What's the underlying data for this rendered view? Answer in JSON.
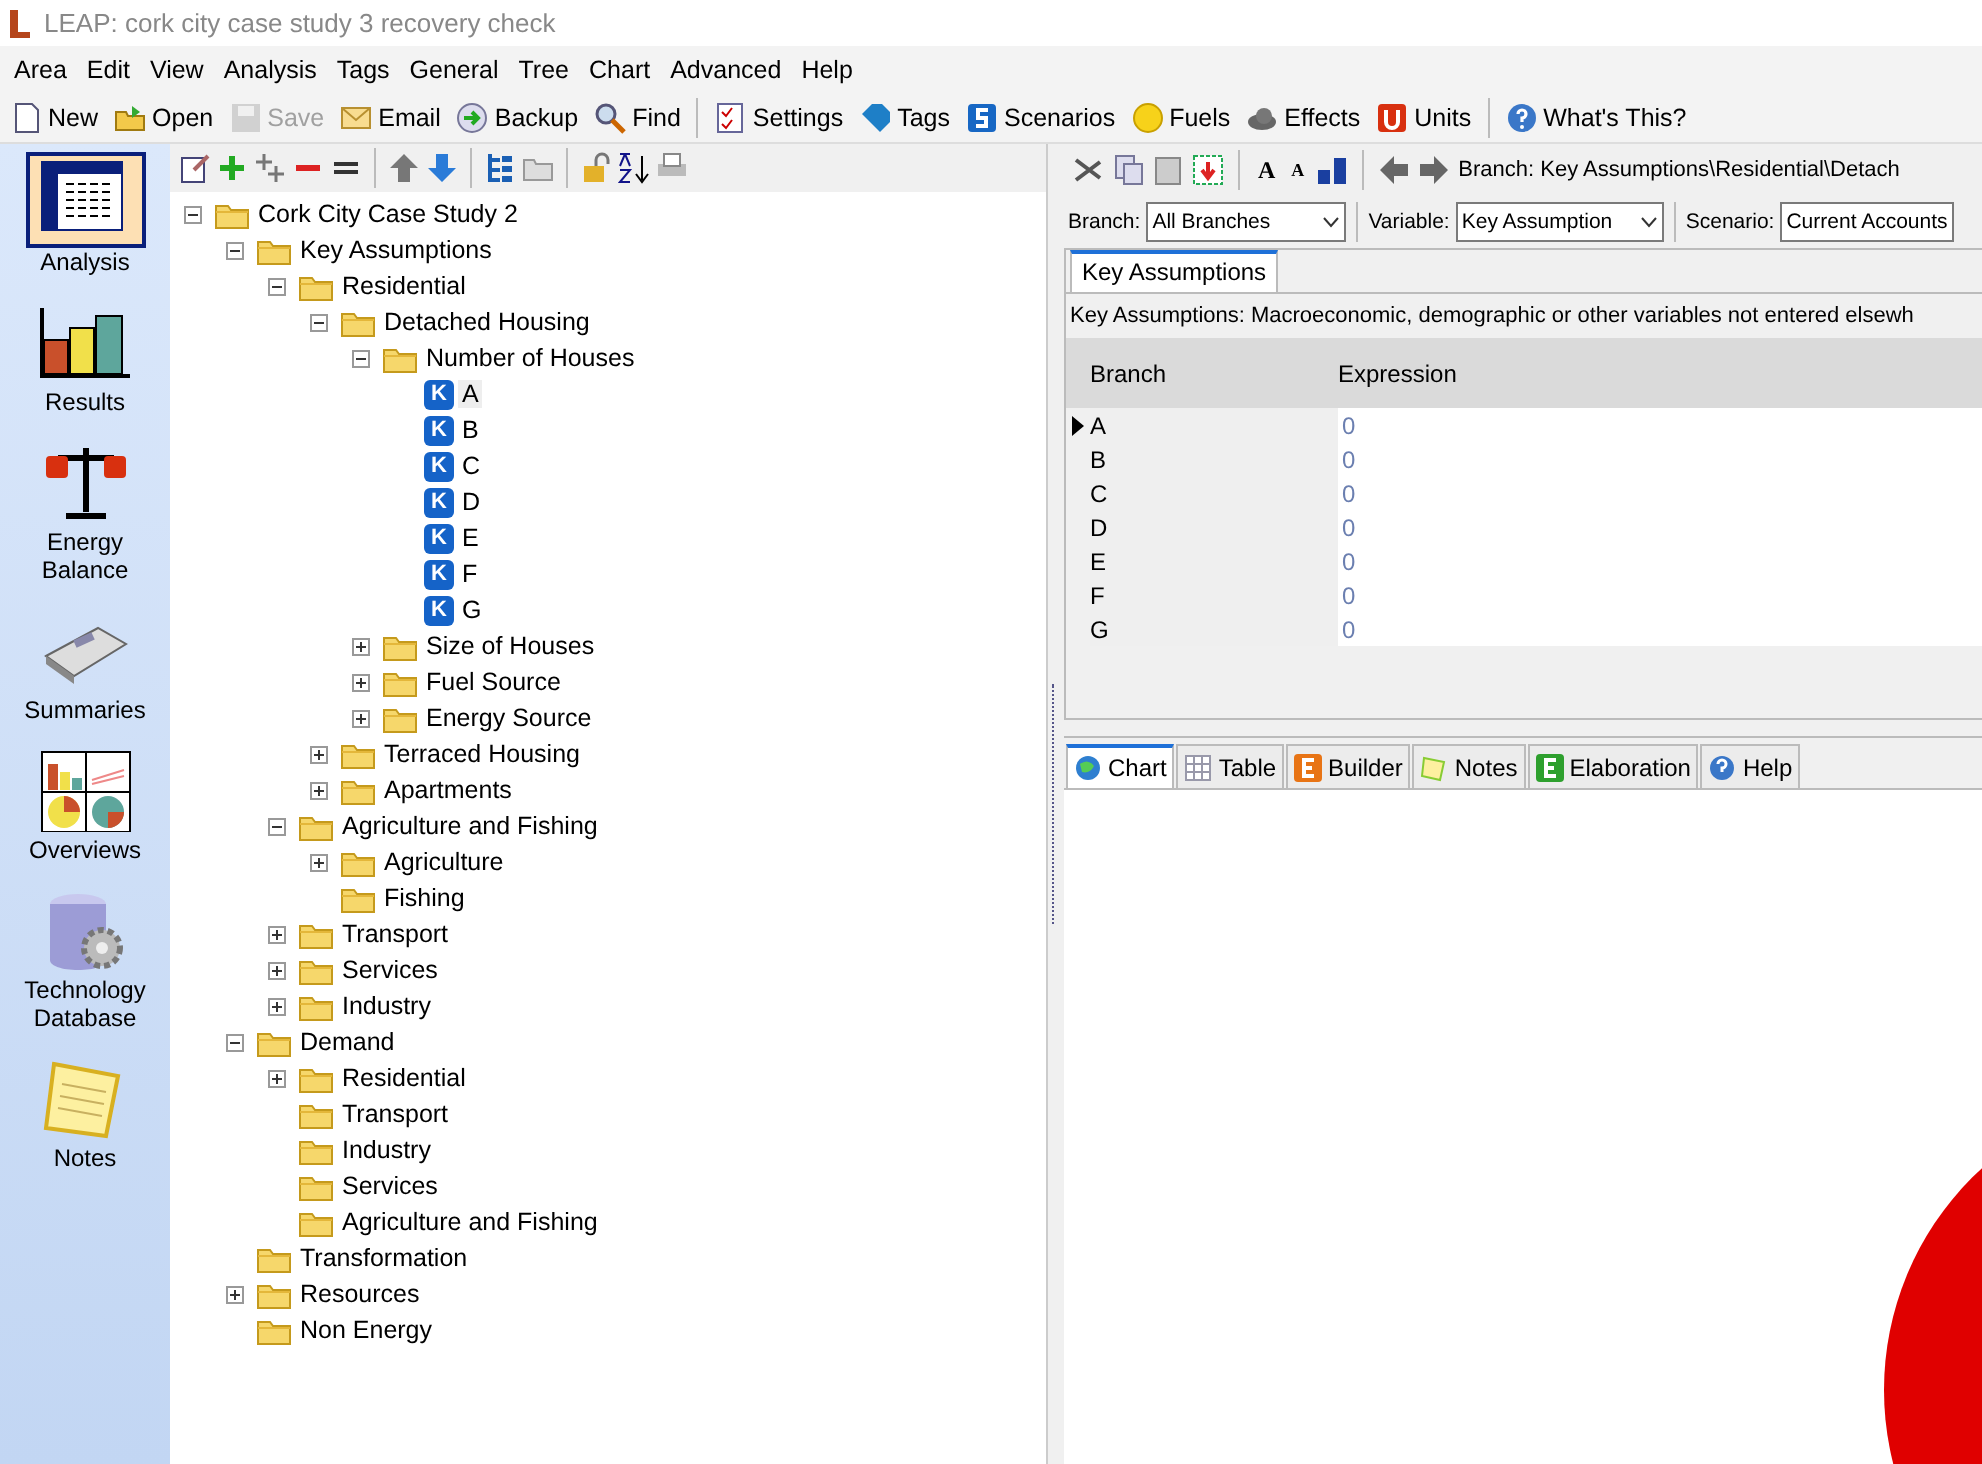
{
  "window": {
    "title": "LEAP: cork city case study 3 recovery check"
  },
  "menu": [
    "Area",
    "Edit",
    "View",
    "Analysis",
    "Tags",
    "General",
    "Tree",
    "Chart",
    "Advanced",
    "Help"
  ],
  "toolbar": [
    {
      "label": "New",
      "disabled": false
    },
    {
      "label": "Open",
      "disabled": false
    },
    {
      "label": "Save",
      "disabled": true
    },
    {
      "label": "Email",
      "disabled": false
    },
    {
      "label": "Backup",
      "disabled": false
    },
    {
      "label": "Find",
      "disabled": false
    },
    {
      "label": "Settings",
      "disabled": false
    },
    {
      "label": "Tags",
      "disabled": false
    },
    {
      "label": "Scenarios",
      "disabled": false
    },
    {
      "label": "Fuels",
      "disabled": false
    },
    {
      "label": "Effects",
      "disabled": false
    },
    {
      "label": "Units",
      "disabled": false
    },
    {
      "label": "What's This?",
      "disabled": false
    }
  ],
  "sidebar": {
    "items": [
      {
        "label": "Analysis",
        "selected": true
      },
      {
        "label": "Results",
        "selected": false
      },
      {
        "label": "Energy Balance",
        "selected": false
      },
      {
        "label": "Summaries",
        "selected": false
      },
      {
        "label": "Overviews",
        "selected": false
      },
      {
        "label": "Technology Database",
        "selected": false
      },
      {
        "label": "Notes",
        "selected": false
      }
    ]
  },
  "tree": {
    "root": {
      "label": "Cork City Case Study 2",
      "kind": "folder",
      "expanded": true,
      "selected": false,
      "children": [
        {
          "label": "Key Assumptions",
          "kind": "folder",
          "expanded": true,
          "selected": false,
          "children": [
            {
              "label": "Residential",
              "kind": "folder",
              "expanded": true,
              "selected": false,
              "children": [
                {
                  "label": "Detached Housing",
                  "kind": "folder",
                  "expanded": true,
                  "selected": false,
                  "children": [
                    {
                      "label": "Number of Houses",
                      "kind": "folder",
                      "expanded": true,
                      "selected": false,
                      "children": [
                        {
                          "label": "A",
                          "kind": "key",
                          "badge": "K",
                          "selected": true
                        },
                        {
                          "label": "B",
                          "kind": "key",
                          "badge": "K",
                          "selected": false
                        },
                        {
                          "label": "C",
                          "kind": "key",
                          "badge": "K",
                          "selected": false
                        },
                        {
                          "label": "D",
                          "kind": "key",
                          "badge": "K",
                          "selected": false
                        },
                        {
                          "label": "E",
                          "kind": "key",
                          "badge": "K",
                          "selected": false
                        },
                        {
                          "label": "F",
                          "kind": "key",
                          "badge": "K",
                          "selected": false
                        },
                        {
                          "label": "G",
                          "kind": "key",
                          "badge": "K",
                          "selected": false
                        }
                      ]
                    },
                    {
                      "label": "Size of Houses",
                      "kind": "folder",
                      "expanded": false,
                      "selected": false
                    },
                    {
                      "label": "Fuel Source",
                      "kind": "folder",
                      "expanded": false,
                      "selected": false
                    },
                    {
                      "label": "Energy Source",
                      "kind": "folder",
                      "expanded": false,
                      "selected": false
                    }
                  ]
                },
                {
                  "label": "Terraced Housing",
                  "kind": "folder",
                  "expanded": false,
                  "selected": false
                },
                {
                  "label": "Apartments",
                  "kind": "folder",
                  "expanded": false,
                  "selected": false
                }
              ]
            },
            {
              "label": "Agriculture and Fishing",
              "kind": "folder",
              "expanded": true,
              "selected": false,
              "children": [
                {
                  "label": "Agriculture",
                  "kind": "folder",
                  "expanded": false,
                  "selected": false
                },
                {
                  "label": "Fishing",
                  "kind": "folder",
                  "selected": false
                }
              ]
            },
            {
              "label": "Transport",
              "kind": "folder",
              "expanded": false,
              "selected": false
            },
            {
              "label": "Services",
              "kind": "folder",
              "expanded": false,
              "selected": false
            },
            {
              "label": "Industry",
              "kind": "folder",
              "expanded": false,
              "selected": false
            }
          ]
        },
        {
          "label": "Demand",
          "kind": "folder",
          "expanded": true,
          "selected": false,
          "children": [
            {
              "label": "Residential",
              "kind": "folder",
              "expanded": false,
              "selected": false
            },
            {
              "label": "Transport",
              "kind": "folder",
              "selected": false
            },
            {
              "label": "Industry",
              "kind": "folder",
              "selected": false
            },
            {
              "label": "Services",
              "kind": "folder",
              "selected": false
            },
            {
              "label": "Agriculture and Fishing",
              "kind": "folder",
              "selected": false
            }
          ]
        },
        {
          "label": "Transformation",
          "kind": "folder",
          "selected": false
        },
        {
          "label": "Resources",
          "kind": "folder",
          "expanded": false,
          "selected": false
        },
        {
          "label": "Non Energy",
          "kind": "folder",
          "selected": false
        }
      ]
    }
  },
  "font_buttons": [
    {
      "label": "A",
      "kind": "larger"
    },
    {
      "label": "A",
      "kind": "smaller"
    }
  ],
  "breadcrumb": "Branch: Key Assumptions\\Residential\\Detach",
  "filters": [
    {
      "label": "Branch:",
      "value": "All Branches"
    },
    {
      "label": "Variable:",
      "value": "Key Assumption"
    },
    {
      "label": "Scenario:",
      "value": "Current Accounts"
    }
  ],
  "data_tabs": [
    {
      "label": "Key Assumptions",
      "selected": true
    }
  ],
  "description": "Key Assumptions: Macroeconomic, demographic or other variables not entered elsewh",
  "table": {
    "columns": [
      "Branch",
      "Expression"
    ],
    "rows": [
      {
        "branch": "A",
        "expression": "0",
        "selected": true
      },
      {
        "branch": "B",
        "expression": "0",
        "selected": false
      },
      {
        "branch": "C",
        "expression": "0",
        "selected": false
      },
      {
        "branch": "D",
        "expression": "0",
        "selected": false
      },
      {
        "branch": "E",
        "expression": "0",
        "selected": false
      },
      {
        "branch": "F",
        "expression": "0",
        "selected": false
      },
      {
        "branch": "G",
        "expression": "0",
        "selected": false
      }
    ]
  },
  "view_tabs": [
    {
      "label": "Chart",
      "selected": true
    },
    {
      "label": "Table",
      "selected": false
    },
    {
      "label": "Builder",
      "selected": false
    },
    {
      "label": "Notes",
      "selected": false
    },
    {
      "label": "Elaboration",
      "selected": false
    },
    {
      "label": "Help",
      "selected": false
    }
  ]
}
